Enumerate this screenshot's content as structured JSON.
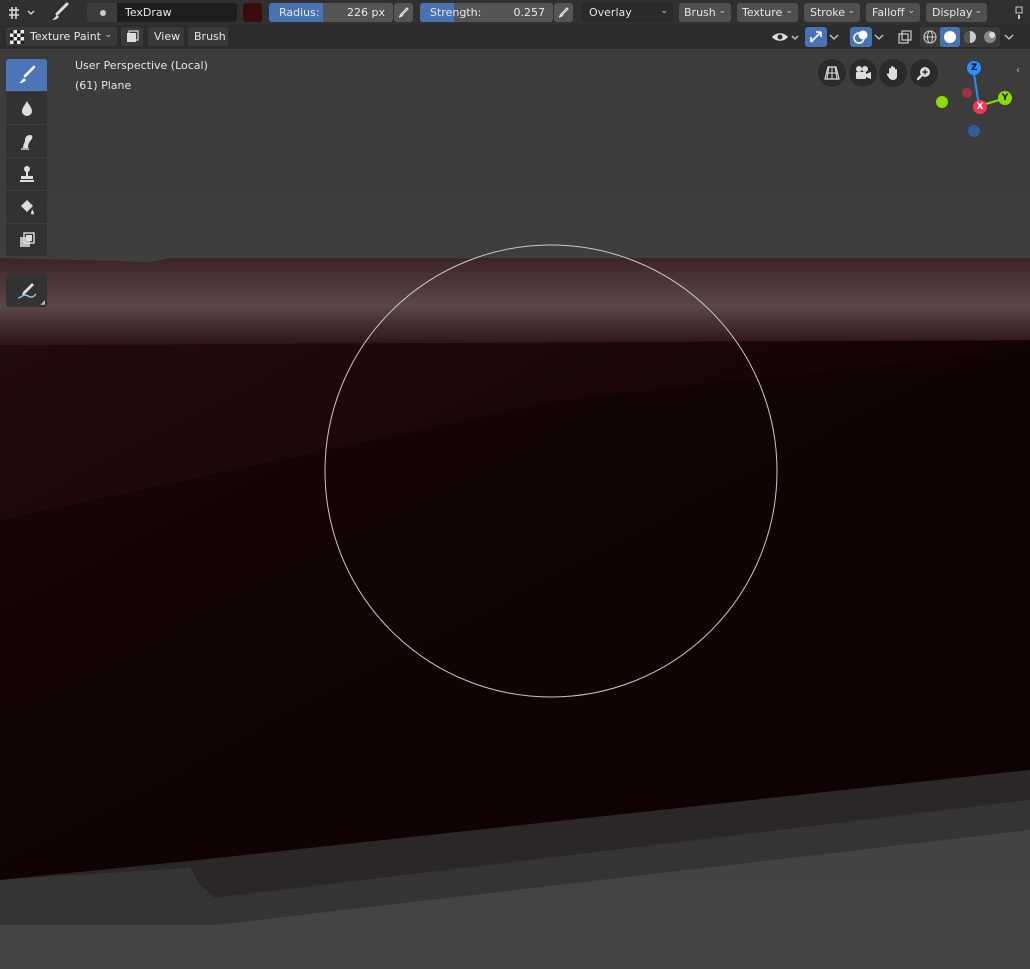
{
  "header": {
    "brush_name": "TexDraw",
    "color": "#3a0d0d",
    "radius": {
      "label": "Radius:",
      "value": "226 px"
    },
    "strength": {
      "label": "Strength:",
      "value": "0.257",
      "fraction": 0.257
    },
    "blend_mode": "Overlay",
    "menus": [
      "Brush",
      "Texture",
      "Stroke",
      "Falloff",
      "Display"
    ]
  },
  "header2": {
    "mode": "Texture Paint",
    "menus": [
      "View",
      "Brush"
    ]
  },
  "viewport": {
    "perspective_label": "User Perspective (Local)",
    "object_label": "(61) Plane",
    "gizmo": {
      "z": "Z",
      "y": "Y",
      "x": "X"
    }
  },
  "colors": {
    "accent": "#4772b3",
    "axis_x": "#ff3352",
    "axis_y": "#8bdc00",
    "axis_z": "#2890ff"
  }
}
